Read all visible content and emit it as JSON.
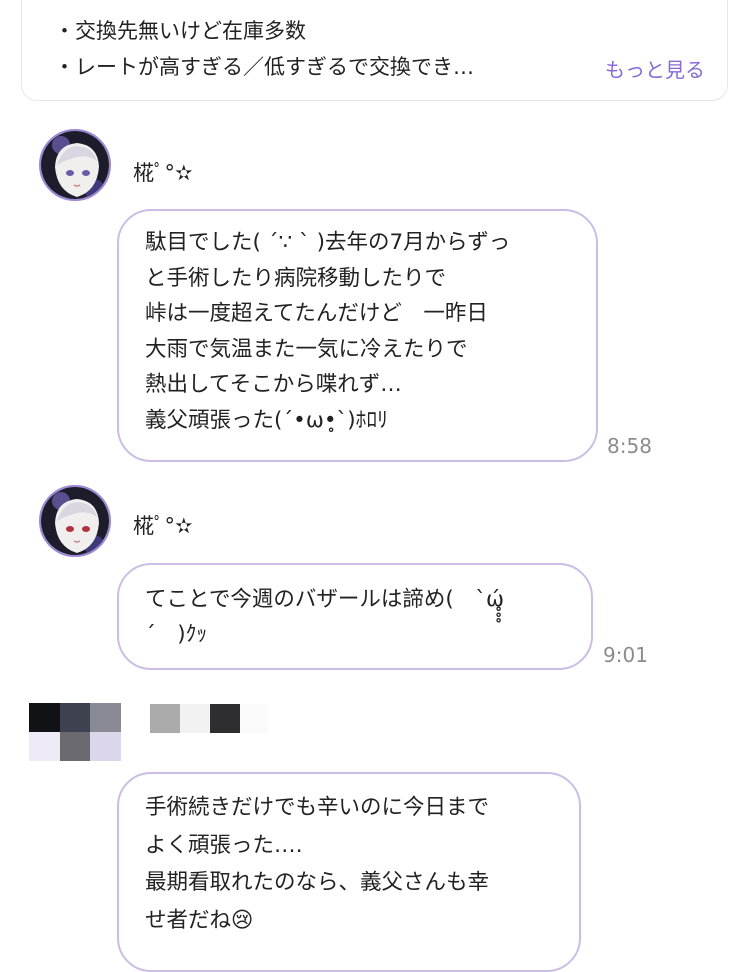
{
  "pinned_post": {
    "line1": "・交換先無いけど在庫多数",
    "line2": "・レートが高すぎる／低すぎるで交換でき…",
    "more_label": "もっと見る"
  },
  "messages": [
    {
      "username": "椛ﾟ°✫",
      "lines": [
        "駄目でした( ´∵ ` )去年の7月からずっ",
        "と手術したり病院移動したりで",
        "峠は一度超えてたんだけど　一昨日",
        "大雨で気温また一気に冷えたりで",
        "熱出してそこから喋れず…",
        "義父頑張った(´•ω•̥`)ﾎﾛﾘ"
      ],
      "time": "8:58"
    },
    {
      "username": "椛ﾟ°✫",
      "lines": [
        "てことで今週のバザールは諦め(　`ώ̥̥̥",
        "´　)ｸｯ"
      ],
      "time": "9:01"
    },
    {
      "username": "",
      "lines": [
        "手術続きだけでも辛いのに今日まで",
        "よく頑張った‥‥",
        "最期看取れたのなら、義父さんも幸",
        "せ者だね😢"
      ],
      "time": ""
    }
  ],
  "colors": {
    "accent": "#8a68d8",
    "bubble_border": "#cbbde6",
    "time": "#8c8c8c"
  }
}
